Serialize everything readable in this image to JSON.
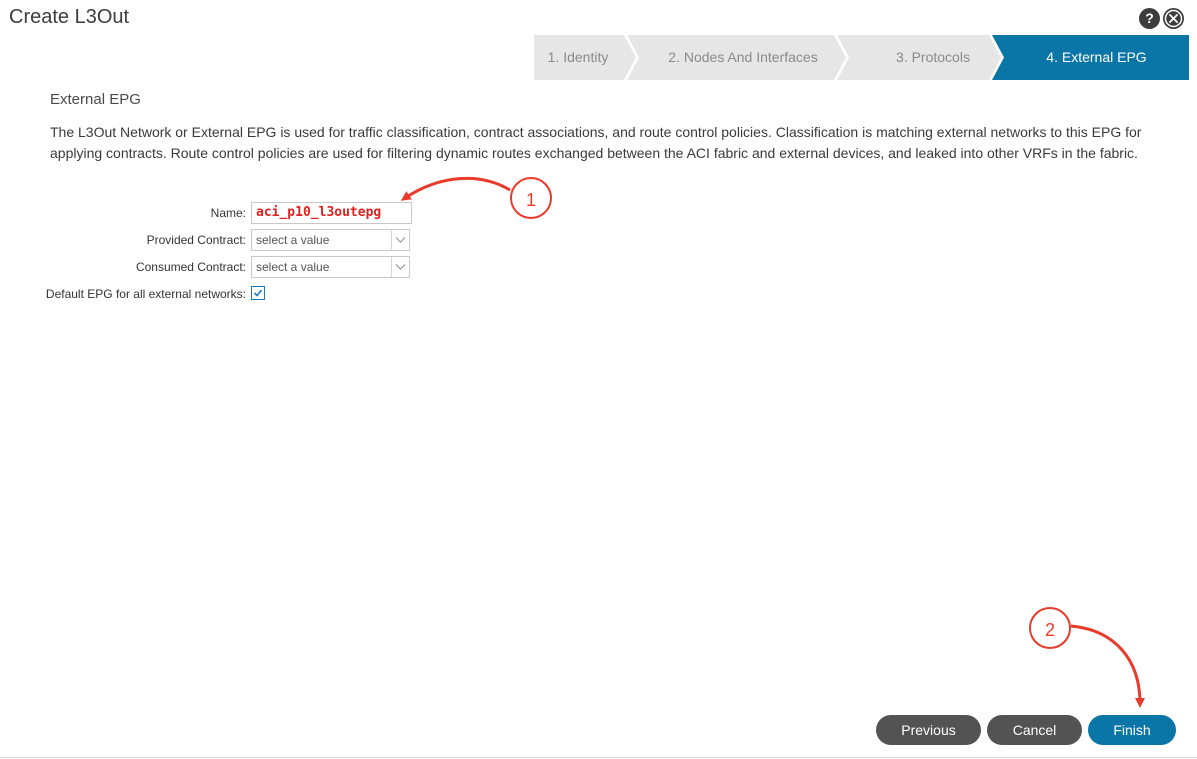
{
  "window": {
    "title": "Create L3Out",
    "help_label": "?"
  },
  "wizard": {
    "steps": [
      {
        "label": "1. Identity",
        "active": false
      },
      {
        "label": "2. Nodes And Interfaces",
        "active": false
      },
      {
        "label": "3. Protocols",
        "active": false
      },
      {
        "label": "4. External EPG",
        "active": true
      }
    ],
    "colors": {
      "inactive": "#e6e6e6",
      "active": "#0a76a8"
    }
  },
  "section": {
    "title": "External EPG",
    "description": "The L3Out Network or External EPG is used for traffic classification, contract associations, and route control policies. Classification is matching external networks to this EPG for applying contracts. Route control policies are used for filtering dynamic routes exchanged between the ACI fabric and external devices, and leaked into other VRFs in the fabric."
  },
  "form": {
    "name_label": "Name:",
    "name_value": "aci_p10_l3outepg",
    "provided_label": "Provided Contract:",
    "provided_placeholder": "select a value",
    "consumed_label": "Consumed Contract:",
    "consumed_placeholder": "select a value",
    "default_epg_label": "Default EPG for all external networks:",
    "default_epg_checked": true
  },
  "annotations": {
    "badge1": "1",
    "badge2": "2",
    "color": "#e83b2c"
  },
  "footer": {
    "previous_label": "Previous",
    "cancel_label": "Cancel",
    "finish_label": "Finish"
  }
}
